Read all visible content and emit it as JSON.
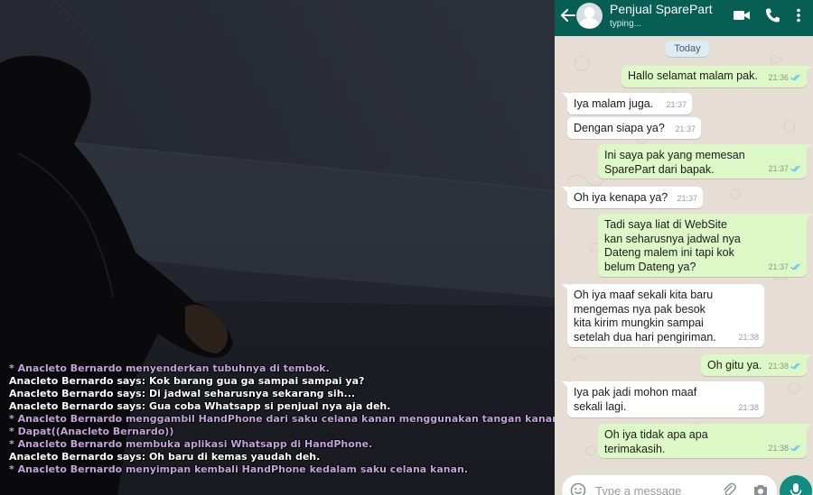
{
  "game": {
    "chat_log": [
      {
        "type": "me",
        "text": "* Anacleto Bernardo menyenderkan tubuhnya di tembok."
      },
      {
        "type": "say",
        "text": "Anacleto Bernardo says: Kok barang gua ga sampai sampai ya?"
      },
      {
        "type": "say",
        "text": "Anacleto Bernardo says: Di jadwal seharusnya sekarang sih..."
      },
      {
        "type": "say",
        "text": "Anacleto Bernardo says: Gua coba Whatsapp si penjual nya aja deh."
      },
      {
        "type": "me",
        "text": "* Anacleto Bernardo menggambil HandPhone dari saku celana kanan menggunakan tangan kanan."
      },
      {
        "type": "me",
        "text": "* Dapat((Anacleto Bernardo))"
      },
      {
        "type": "me",
        "text": "* Anacleto Bernardo membuka aplikasi Whatsapp di HandPhone."
      },
      {
        "type": "say",
        "text": "Anacleto Bernardo says: Oh baru di kemas yaudah deh."
      },
      {
        "type": "me",
        "text": "* Anacleto Bernardo menyimpan kembali HandPhone kedalam saku celana kanan."
      }
    ],
    "colors": {
      "me": "#c2a2da",
      "say": "#ffffff"
    }
  },
  "whatsapp": {
    "contact_name": "Penjual SparePart",
    "status": "typing...",
    "date_chip": "Today",
    "colors": {
      "header": "#075e54",
      "outgoing": "#dcf8c6",
      "incoming": "#ffffff",
      "read_ticks": "#4fc3f7"
    },
    "messages": [
      {
        "dir": "out",
        "text": "Hallo selamat malam pak.",
        "time": "21:36",
        "read": true
      },
      {
        "dir": "in",
        "text": "Iya malam juga.",
        "time": "21:37"
      },
      {
        "dir": "in",
        "text": "Dengan siapa ya?",
        "time": "21:37"
      },
      {
        "dir": "out",
        "text": "Ini saya pak yang memesan\nSparePart dari bapak.",
        "time": "21:37",
        "read": true
      },
      {
        "dir": "in",
        "text": "Oh iya kenapa ya?",
        "time": "21:37"
      },
      {
        "dir": "out",
        "text": "Tadi saya liat di WebSite\nkan seharusnya jadwal nya\nDateng malem ini tapi kok\nbelum Dateng ya?",
        "time": "21:37",
        "read": true
      },
      {
        "dir": "in",
        "text": "Oh iya maaf sekali kita baru\nmengemas nya pak besok\nkita kirim mungkin sampai\nsetelah dua hari pengiriman.",
        "time": "21:38"
      },
      {
        "dir": "out",
        "text": "Oh gitu ya.",
        "time": "21:38",
        "read": true
      },
      {
        "dir": "in",
        "text": "Iya pak jadi mohon maaf\nsekali lagi.",
        "time": "21:38"
      },
      {
        "dir": "out",
        "text": "Oh iya tidak apa apa\nterimakasih.",
        "time": "21:38",
        "read": true
      }
    ],
    "composer_placeholder": "Type a message",
    "icons": {
      "back": "arrow-left",
      "video": "video-camera",
      "call": "phone",
      "menu": "more-vertical",
      "emoji": "smiley",
      "attach": "paperclip",
      "camera": "camera",
      "mic": "microphone"
    }
  }
}
